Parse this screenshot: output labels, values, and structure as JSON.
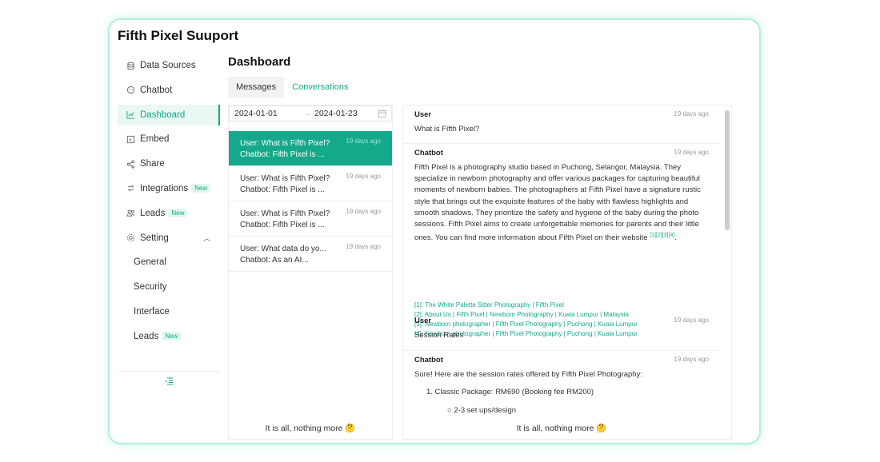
{
  "app": {
    "title": "Fifth Pixel Suuport"
  },
  "sidebar": {
    "items": [
      {
        "label": "Data Sources",
        "icon": "database-icon"
      },
      {
        "label": "Chatbot",
        "icon": "chat-bubble-icon"
      },
      {
        "label": "Dashboard",
        "icon": "chart-line-icon",
        "active": true
      },
      {
        "label": "Embed",
        "icon": "embed-icon"
      },
      {
        "label": "Share",
        "icon": "share-icon"
      },
      {
        "label": "Integrations",
        "icon": "integrations-icon",
        "badge": "New"
      },
      {
        "label": "Leads",
        "icon": "leads-icon",
        "badge": "New"
      },
      {
        "label": "Setting",
        "icon": "gear-icon"
      }
    ],
    "settings_children": [
      {
        "label": "General"
      },
      {
        "label": "Security"
      },
      {
        "label": "Interface"
      },
      {
        "label": "Leads",
        "badge": "New"
      }
    ],
    "collapse_icon": "collapse-menu-icon"
  },
  "main": {
    "title": "Dashboard",
    "tabs": [
      {
        "label": "Messages"
      },
      {
        "label": "Conversations"
      }
    ]
  },
  "date_range": {
    "start": "2024-01-01",
    "end": "2024-01-23"
  },
  "conversations": [
    {
      "line1": "User: What is Fifth Pixel?",
      "line2": "Chatbot: Fifth Pixel is ...",
      "time": "19 days ago",
      "selected": true
    },
    {
      "line1": "User: What is Fifth Pixel?",
      "line2": "Chatbot: Fifth Pixel is ...",
      "time": "19 days ago"
    },
    {
      "line1": "User: What is Fifth Pixel?",
      "line2": "Chatbot: Fifth Pixel is ...",
      "time": "19 days ago"
    },
    {
      "line1": "User: What data do yo...",
      "line2": "Chatbot: As an AI...",
      "time": "19 days ago"
    }
  ],
  "list_footer": "It is all, nothing more 🤔",
  "chat": {
    "messages": [
      {
        "role": "User",
        "time": "19 days ago",
        "text": "What is Fifth Pixel?"
      },
      {
        "role": "Chatbot",
        "time": "19 days ago",
        "text": "Fifth Pixel is a photography studio based in Puchong, Selangor, Malaysia. They specialize in newborn photography and offer various packages for capturing beautiful moments of newborn babies. The photographers at Fifth Pixel have a signature rustic style that brings out the exquisite features of the baby with flawless highlights and smooth shadows. They prioritize the safety and hygiene of the baby during the photo sessions. Fifth Pixel aims to create unforgettable memories for parents and their little ones. You can find more information about Fifth Pixel on their website",
        "citation": "[1][2][3][4]",
        "period": "."
      },
      {
        "role": "User",
        "time": "19 days ago",
        "text": "Session Rates"
      },
      {
        "role": "Chatbot",
        "time": "19 days ago",
        "text": "Sure! Here are the session rates offered by Fifth Pixel Photography:"
      }
    ],
    "references": [
      "[1]: The White Palette Sitter Photography | Fifth Pixel",
      "[2]: About Us | Fifth Pixel | Newborn Photography | Kuala Lumpur | Malaysia",
      "[3]: Newborn photographer | Fifth Pixel Photography | Puchong | Kuala Lumpur",
      "[4]: Newborn photographer | Fifth Pixel Photography | Puchong | Kuala Lumpur"
    ],
    "list_item": "1. Classic Package: RM690 (Booking fee RM200)",
    "sub_item": "○ 2-3 set ups/design",
    "footer": "It is all, nothing more 🤔"
  },
  "colors": {
    "accent": "#14a98a",
    "frame_border": "#b4f0db",
    "active_bg": "#e9f8f3"
  }
}
